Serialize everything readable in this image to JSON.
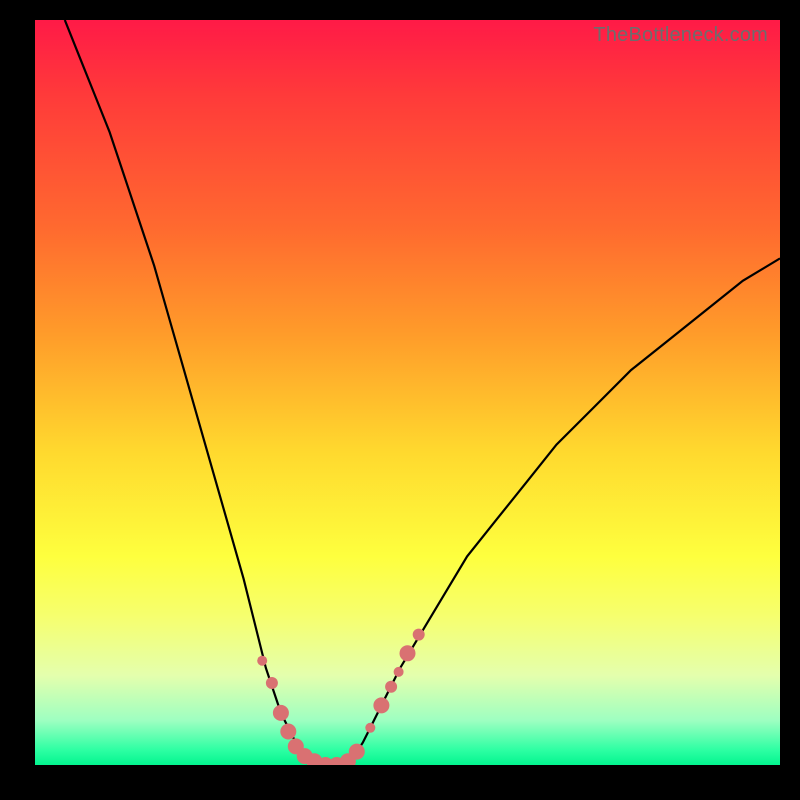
{
  "watermark": "TheBottleneck.com",
  "chart_data": {
    "type": "line",
    "title": "",
    "xlabel": "",
    "ylabel": "",
    "xlim": [
      0,
      100
    ],
    "ylim": [
      0,
      100
    ],
    "grid": false,
    "series": [
      {
        "name": "bottleneck-curve",
        "x": [
          4,
          6,
          8,
          10,
          12,
          14,
          16,
          18,
          20,
          22,
          24,
          26,
          28,
          30,
          31,
          32,
          33,
          34,
          35,
          36,
          37,
          38,
          39,
          40,
          41,
          42,
          43,
          44,
          45,
          47,
          49,
          52,
          55,
          58,
          62,
          66,
          70,
          75,
          80,
          85,
          90,
          95,
          100
        ],
        "y": [
          100,
          95,
          90,
          85,
          79,
          73,
          67,
          60,
          53,
          46,
          39,
          32,
          25,
          17,
          13,
          10,
          7,
          5,
          3,
          1.5,
          0.5,
          0,
          0,
          0,
          0,
          0.5,
          1.5,
          3,
          5,
          9,
          13,
          18,
          23,
          28,
          33,
          38,
          43,
          48,
          53,
          57,
          61,
          65,
          68
        ]
      }
    ],
    "markers": [
      {
        "x": 30.5,
        "y": 14,
        "r": 5
      },
      {
        "x": 31.8,
        "y": 11,
        "r": 6
      },
      {
        "x": 33,
        "y": 7,
        "r": 8
      },
      {
        "x": 34,
        "y": 4.5,
        "r": 8
      },
      {
        "x": 35,
        "y": 2.5,
        "r": 8
      },
      {
        "x": 36.2,
        "y": 1.2,
        "r": 8
      },
      {
        "x": 37.5,
        "y": 0.5,
        "r": 8
      },
      {
        "x": 39,
        "y": 0,
        "r": 8
      },
      {
        "x": 40.5,
        "y": 0,
        "r": 8
      },
      {
        "x": 42,
        "y": 0.5,
        "r": 8
      },
      {
        "x": 43.2,
        "y": 1.8,
        "r": 8
      },
      {
        "x": 45,
        "y": 5,
        "r": 5
      },
      {
        "x": 46.5,
        "y": 8,
        "r": 8
      },
      {
        "x": 47.8,
        "y": 10.5,
        "r": 6
      },
      {
        "x": 48.8,
        "y": 12.5,
        "r": 5
      },
      {
        "x": 50,
        "y": 15,
        "r": 8
      },
      {
        "x": 51.5,
        "y": 17.5,
        "r": 6
      }
    ],
    "marker_color": "#d97172",
    "curve_color": "#000000"
  }
}
